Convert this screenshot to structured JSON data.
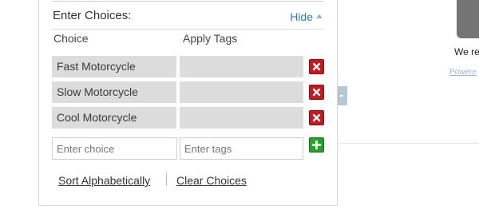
{
  "panel": {
    "title": "Enter Choices:",
    "hide_label": "Hide",
    "columns": {
      "choice": "Choice",
      "tags": "Apply Tags"
    },
    "choices": [
      {
        "label": "Fast Motorcycle",
        "tags": ""
      },
      {
        "label": "Slow Motorcycle",
        "tags": ""
      },
      {
        "label": "Cool Motorcycle",
        "tags": ""
      }
    ],
    "new_choice_placeholder": "Enter choice",
    "new_tags_placeholder": "Enter tags",
    "sort_label": "Sort Alphabetically",
    "clear_label": "Clear Choices"
  },
  "background": {
    "partial_text": "We re",
    "partial_link": "Powere"
  },
  "colors": {
    "delete": "#c8171d",
    "add": "#25a325",
    "link": "#2c7cc9"
  }
}
